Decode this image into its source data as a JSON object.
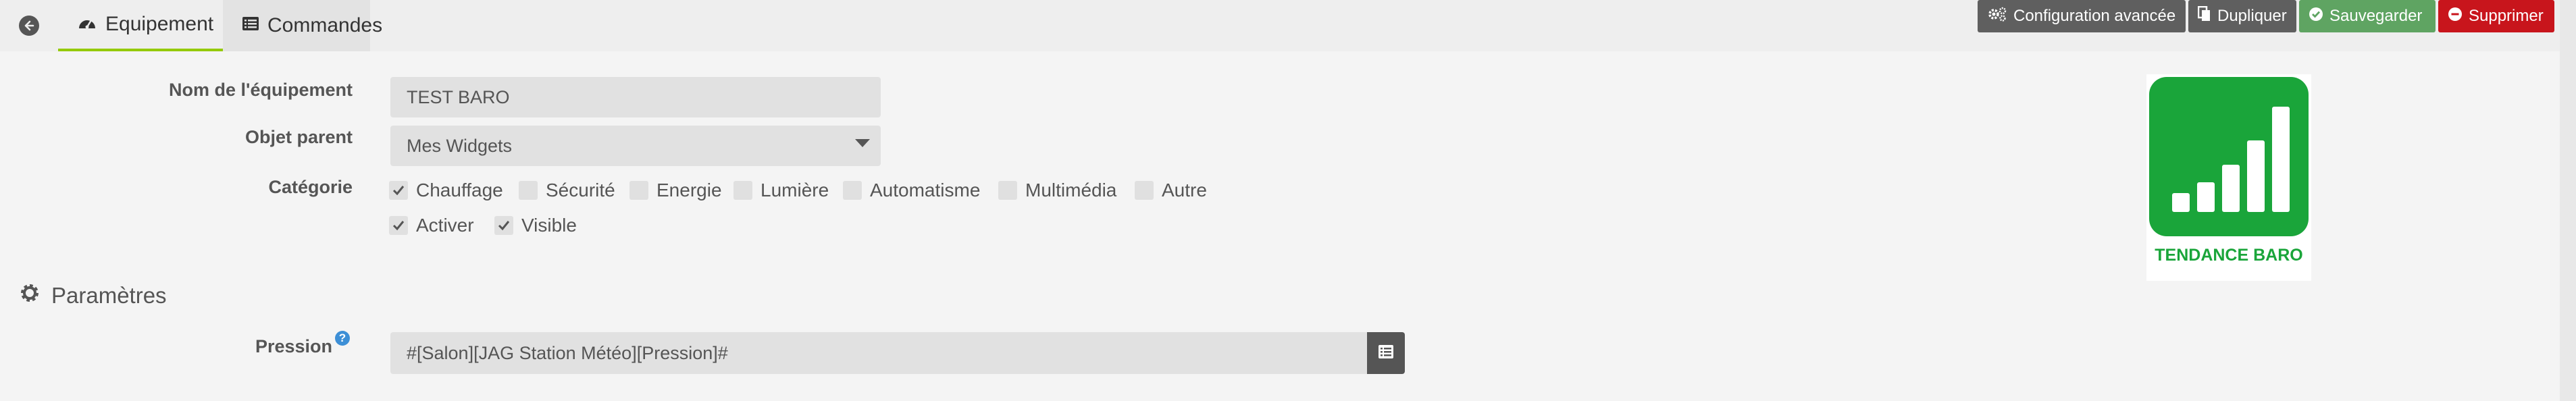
{
  "tabs": [
    {
      "label": "Equipement",
      "icon": "dashboard-icon",
      "active": true
    },
    {
      "label": "Commandes",
      "icon": "list-icon",
      "active": false
    }
  ],
  "actions": {
    "config": "Configuration avancée",
    "duplicate": "Dupliquer",
    "save": "Sauvegarder",
    "delete": "Supprimer"
  },
  "colors": {
    "active_tab_accent": "#94ca02",
    "save": "#5fa462",
    "delete": "#c8151c",
    "neutral_button": "#5f5f5f",
    "logo_green": "#1aa53a",
    "help": "#3d8fd6"
  },
  "form": {
    "name_label": "Nom de l'équipement",
    "name_value": "TEST BARO",
    "parent_label": "Objet parent",
    "parent_value": "Mes Widgets",
    "category_label": "Catégorie",
    "categories": [
      {
        "label": "Chauffage",
        "checked": true
      },
      {
        "label": "Sécurité",
        "checked": false
      },
      {
        "label": "Energie",
        "checked": false
      },
      {
        "label": "Lumière",
        "checked": false
      },
      {
        "label": "Automatisme",
        "checked": false
      },
      {
        "label": "Multimédia",
        "checked": false
      },
      {
        "label": "Autre",
        "checked": false
      }
    ],
    "flags": [
      {
        "label": "Activer",
        "checked": true
      },
      {
        "label": "Visible",
        "checked": true
      }
    ]
  },
  "params": {
    "title": "Paramètres",
    "pressure_label": "Pression",
    "help_icon_text": "?",
    "pressure_value": "#[Salon][JAG Station Météo][Pression]#"
  },
  "logo": {
    "text": "TENDANCE BARO",
    "bar_levels": [
      0.18,
      0.28,
      0.45,
      0.68,
      1.0
    ]
  }
}
